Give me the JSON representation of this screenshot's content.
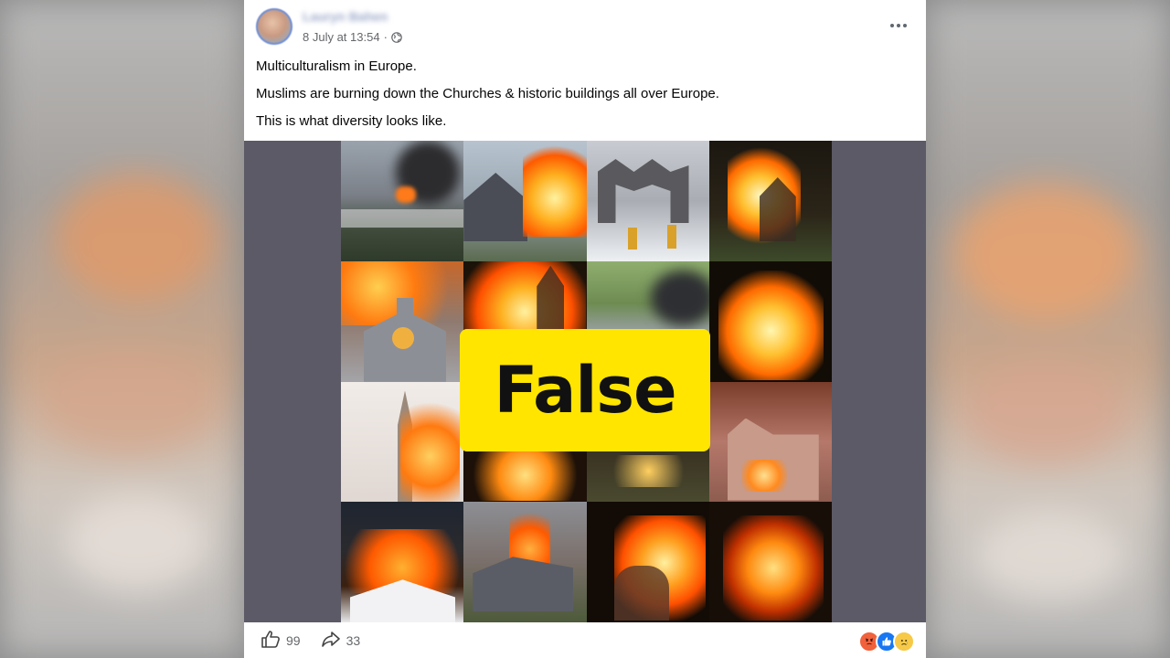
{
  "post": {
    "author": "Lauryn Bahen",
    "timestamp": "8 July at 13:54",
    "separator": "·",
    "lines": [
      "Multiculturalism in Europe.",
      "Muslims are burning down the Churches & historic buildings all over Europe.",
      "This is what diversity looks like."
    ],
    "overlay_label": "False",
    "likes": "99",
    "shares": "33",
    "reaction_icons": [
      "angry-icon",
      "like-icon",
      "sad-icon"
    ],
    "colors": {
      "overlay_bg": "#ffe500",
      "media_bg": "#5c5a66",
      "like_blue": "#1877f2",
      "angry_orange": "#f0613c",
      "sad_yellow": "#f7c948"
    }
  }
}
